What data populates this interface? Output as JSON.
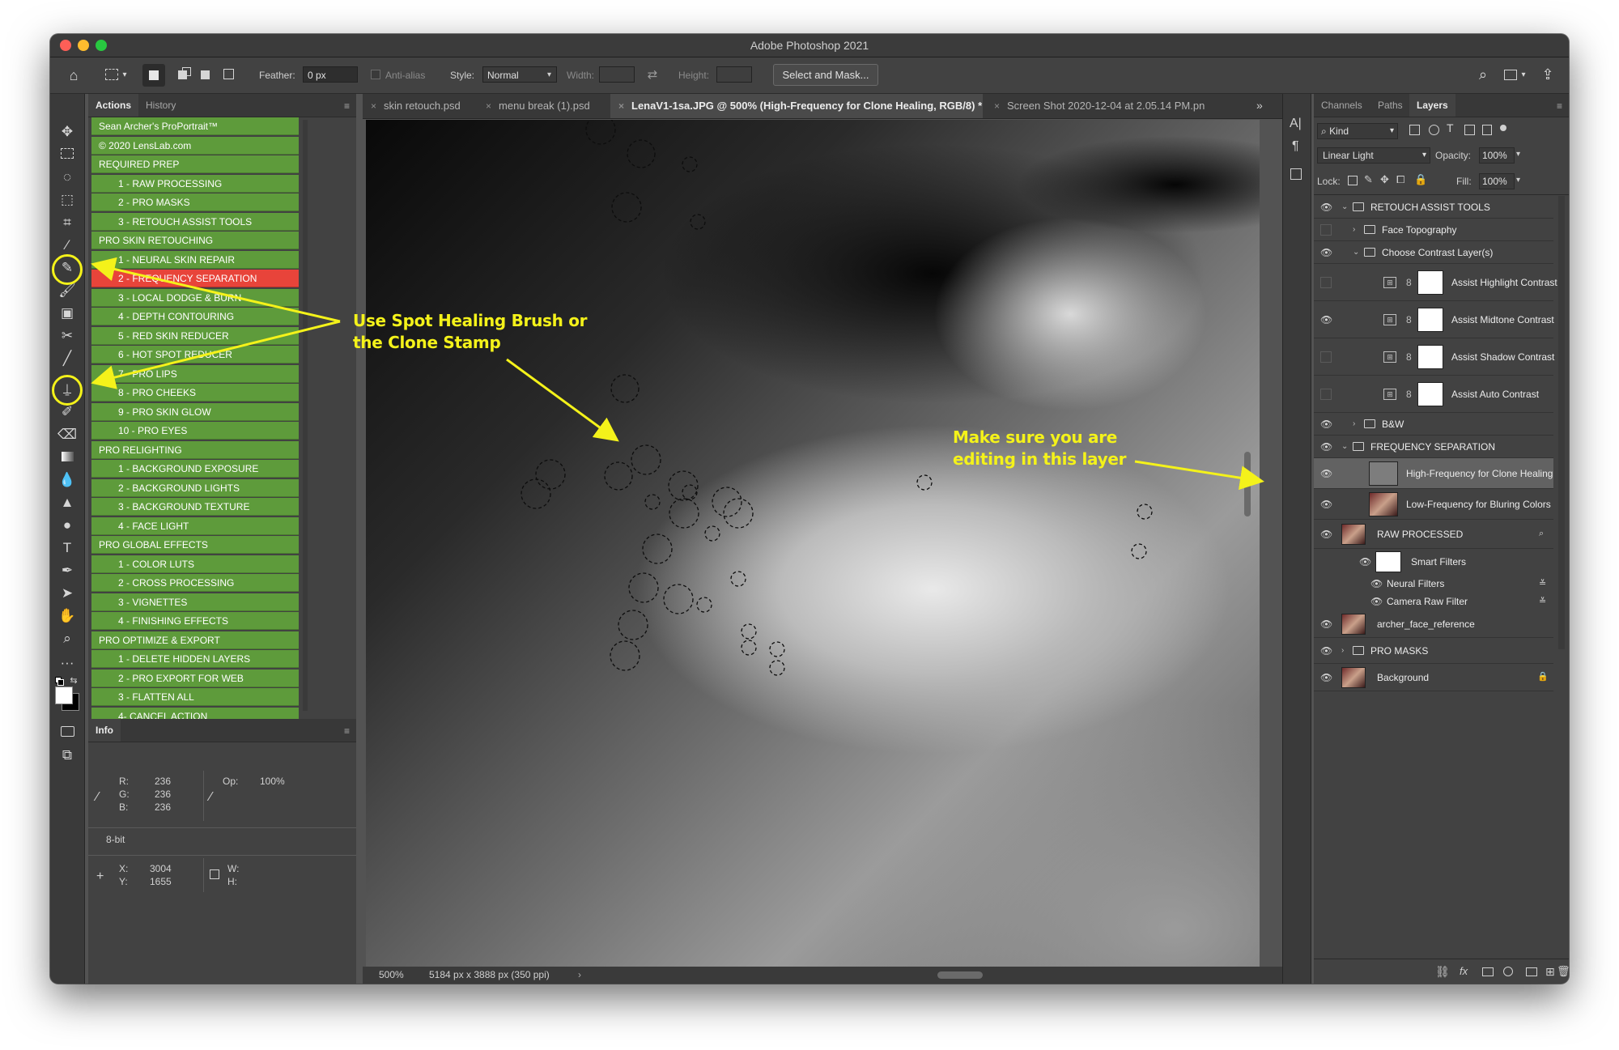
{
  "app": {
    "title": "Adobe Photoshop 2021"
  },
  "options_bar": {
    "feather_label": "Feather:",
    "feather_value": "0 px",
    "antialias_label": "Anti-alias",
    "style_label": "Style:",
    "style_value": "Normal",
    "width_label": "Width:",
    "height_label": "Height:",
    "select_mask_label": "Select and Mask..."
  },
  "left_panel": {
    "tabs": [
      {
        "label": "Actions"
      },
      {
        "label": "History"
      }
    ],
    "actions": [
      {
        "label": "Sean Archer's ProPortrait™",
        "kind": "set"
      },
      {
        "label": "© 2020 LensLab.com",
        "kind": "set"
      },
      {
        "label": "REQUIRED PREP",
        "kind": "set"
      },
      {
        "label": "1 - RAW PROCESSING",
        "kind": "item"
      },
      {
        "label": "2 - PRO MASKS",
        "kind": "item"
      },
      {
        "label": "3 - RETOUCH ASSIST TOOLS",
        "kind": "item"
      },
      {
        "label": "PRO SKIN RETOUCHING",
        "kind": "set"
      },
      {
        "label": "1 - NEURAL SKIN REPAIR",
        "kind": "item"
      },
      {
        "label": "2 - FREQUENCY SEPARATION",
        "kind": "item",
        "highlight": true
      },
      {
        "label": "3 - LOCAL DODGE & BURN",
        "kind": "item"
      },
      {
        "label": "4 - DEPTH CONTOURING",
        "kind": "item"
      },
      {
        "label": "5 - RED SKIN REDUCER",
        "kind": "item"
      },
      {
        "label": "6 - HOT SPOT REDUCER",
        "kind": "item"
      },
      {
        "label": "7 - PRO LIPS",
        "kind": "item"
      },
      {
        "label": "8 - PRO CHEEKS",
        "kind": "item"
      },
      {
        "label": "9 - PRO SKIN GLOW",
        "kind": "item"
      },
      {
        "label": "10 - PRO EYES",
        "kind": "item"
      },
      {
        "label": "PRO RELIGHTING",
        "kind": "set"
      },
      {
        "label": "1 - BACKGROUND EXPOSURE",
        "kind": "item"
      },
      {
        "label": "2 - BACKGROUND LIGHTS",
        "kind": "item"
      },
      {
        "label": "3 - BACKGROUND TEXTURE",
        "kind": "item"
      },
      {
        "label": "4 - FACE LIGHT",
        "kind": "item"
      },
      {
        "label": "PRO GLOBAL EFFECTS",
        "kind": "set"
      },
      {
        "label": "1 - COLOR LUTS",
        "kind": "item"
      },
      {
        "label": "2 - CROSS PROCESSING",
        "kind": "item"
      },
      {
        "label": "3 - VIGNETTES",
        "kind": "item"
      },
      {
        "label": "4 - FINISHING EFFECTS",
        "kind": "item"
      },
      {
        "label": "PRO OPTIMIZE & EXPORT",
        "kind": "set"
      },
      {
        "label": "1 - DELETE HIDDEN LAYERS",
        "kind": "item"
      },
      {
        "label": "2 - PRO EXPORT FOR WEB",
        "kind": "item"
      },
      {
        "label": "3 - FLATTEN ALL",
        "kind": "item"
      },
      {
        "label": "4- CANCEL ACTION",
        "kind": "item"
      }
    ]
  },
  "info_panel": {
    "tab": "Info",
    "r_label": "R:",
    "r_value": "236",
    "g_label": "G:",
    "g_value": "236",
    "b_label": "B:",
    "b_value": "236",
    "op_label": "Op:",
    "op_value": "100%",
    "bit_depth": "8-bit",
    "x_label": "X:",
    "x_value": "3004",
    "y_label": "Y:",
    "y_value": "1655",
    "w_label": "W:",
    "h_label": "H:"
  },
  "document_tabs": [
    {
      "label": "skin retouch.psd",
      "active": false
    },
    {
      "label": "menu break (1).psd",
      "active": false
    },
    {
      "label": "LenaV1-1sa.JPG @ 500% (High-Frequency for Clone Healing, RGB/8) *",
      "active": true
    },
    {
      "label": "Screen Shot 2020-12-04 at 2.05.14 PM.pn",
      "active": false
    }
  ],
  "status_bar": {
    "zoom": "500%",
    "doc_info": "5184 px x 3888 px (350 ppi)"
  },
  "layers_panel": {
    "tabs": [
      {
        "label": "Channels"
      },
      {
        "label": "Paths"
      },
      {
        "label": "Layers"
      }
    ],
    "kind_label": "Kind",
    "blend_mode": "Linear Light",
    "opacity_label": "Opacity:",
    "opacity_value": "100%",
    "lock_label": "Lock:",
    "fill_label": "Fill:",
    "fill_value": "100%",
    "layers": [
      {
        "name": "RETOUCH ASSIST TOOLS",
        "type": "group",
        "visible": true,
        "expanded": true
      },
      {
        "name": "Face Topography",
        "type": "group",
        "visible": false,
        "expanded": false
      },
      {
        "name": "Choose Contrast Layer(s)",
        "type": "group",
        "visible": true,
        "expanded": true
      },
      {
        "name": "Assist Highlight Contrast",
        "type": "adjustment",
        "visible": false
      },
      {
        "name": "Assist Midtone Contrast",
        "type": "adjustment",
        "visible": true
      },
      {
        "name": "Assist Shadow Contrast",
        "type": "adjustment",
        "visible": false
      },
      {
        "name": "Assist Auto Contrast",
        "type": "adjustment",
        "visible": false
      },
      {
        "name": "B&W",
        "type": "group",
        "visible": true,
        "expanded": false
      },
      {
        "name": "FREQUENCY SEPARATION",
        "type": "group",
        "visible": true,
        "expanded": true
      },
      {
        "name": "High-Frequency for Clone Healing",
        "type": "pixel",
        "visible": true,
        "selected": true
      },
      {
        "name": "Low-Frequency for Bluring Colors",
        "type": "pixel",
        "visible": true
      },
      {
        "name": "RAW PROCESSED",
        "type": "smart",
        "visible": true
      },
      {
        "name": "Smart Filters",
        "type": "filters",
        "visible": true
      },
      {
        "name": "Neural Filters",
        "type": "filter",
        "visible": true
      },
      {
        "name": "Camera Raw Filter",
        "type": "filter",
        "visible": true
      },
      {
        "name": "archer_face_reference",
        "type": "pixel",
        "visible": true
      },
      {
        "name": "PRO MASKS",
        "type": "group",
        "visible": true,
        "expanded": false
      },
      {
        "name": "Background",
        "type": "pixel",
        "visible": true,
        "locked": true
      }
    ]
  },
  "annotations": {
    "left_line1": "Use Spot Healing Brush or",
    "left_line2": "the Clone Stamp",
    "right_line1": "Make sure you are",
    "right_line2": "editing in this layer",
    "color": "#f4f21a"
  },
  "colors": {
    "accent_green": "#5e9b3b",
    "highlight_red": "#e8443a",
    "annotation_yellow": "#f4f21a"
  }
}
